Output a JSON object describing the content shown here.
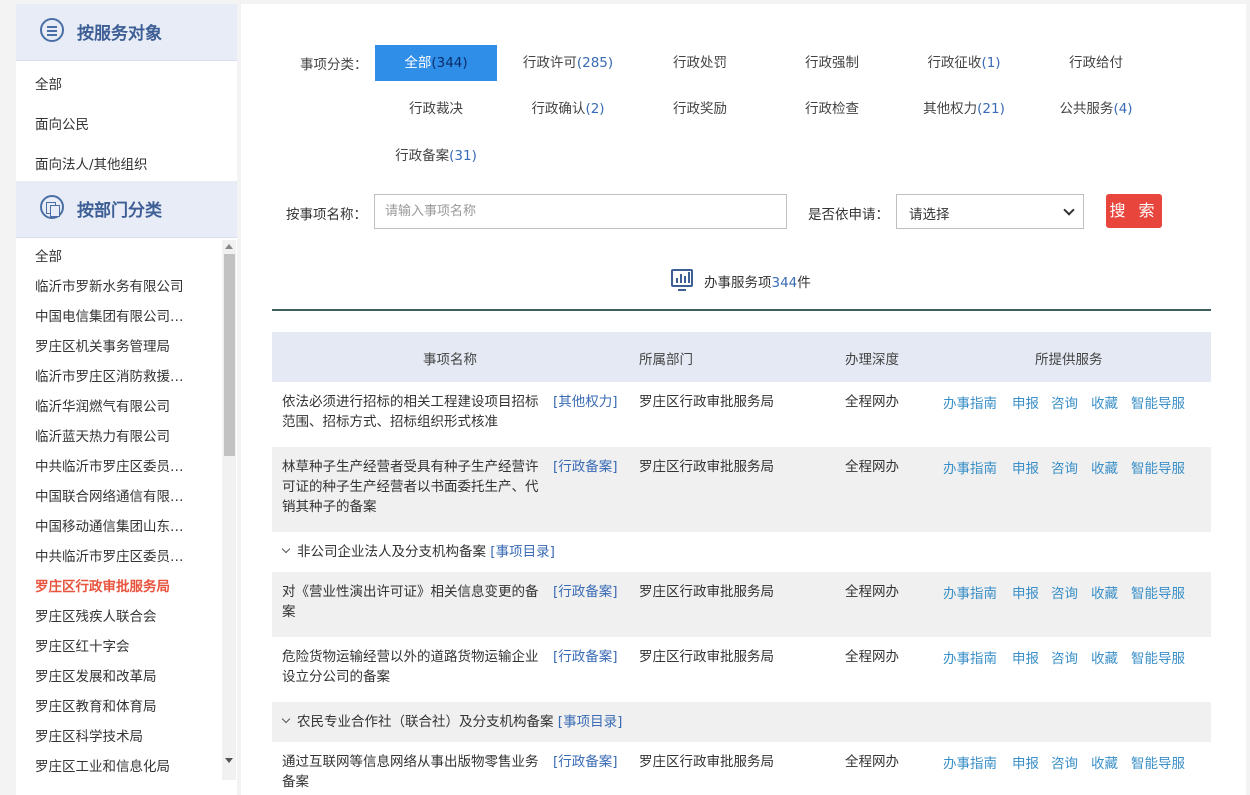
{
  "sidebar": {
    "by_target": {
      "title": "按服务对象",
      "items": [
        "全部",
        "面向公民",
        "面向法人/其他组织"
      ]
    },
    "by_dept": {
      "title": "按部门分类",
      "items": [
        "全部",
        "临沂市罗新水务有限公司",
        "中国电信集团有限公司…",
        "罗庄区机关事务管理局",
        "临沂市罗庄区消防救援…",
        "临沂华润燃气有限公司",
        "临沂蓝天热力有限公司",
        "中共临沂市罗庄区委员…",
        "中国联合网络通信有限…",
        "中国移动通信集团山东…",
        "中共临沂市罗庄区委员…",
        "罗庄区行政审批服务局",
        "罗庄区残疾人联合会",
        "罗庄区红十字会",
        "罗庄区发展和改革局",
        "罗庄区教育和体育局",
        "罗庄区科学技术局",
        "罗庄区工业和信息化局"
      ],
      "active_item": "罗庄区行政审批服务局"
    }
  },
  "filters": {
    "category_label": "事项分类：",
    "categories": [
      {
        "name": "全部",
        "count": "(344)",
        "active": true
      },
      {
        "name": "行政许可",
        "count": "(285)"
      },
      {
        "name": "行政处罚",
        "count": ""
      },
      {
        "name": "行政强制",
        "count": ""
      },
      {
        "name": "行政征收",
        "count": "(1)"
      },
      {
        "name": "行政给付",
        "count": ""
      },
      {
        "name": "行政裁决",
        "count": ""
      },
      {
        "name": "行政确认",
        "count": "(2)"
      },
      {
        "name": "行政奖励",
        "count": ""
      },
      {
        "name": "行政检查",
        "count": ""
      },
      {
        "name": "其他权力",
        "count": "(21)"
      },
      {
        "name": "公共服务",
        "count": "(4)"
      },
      {
        "name": "行政备案",
        "count": "(31)"
      }
    ],
    "name_label": "按事项名称：",
    "name_placeholder": "请输入事项名称",
    "apply_label": "是否依申请：",
    "apply_value": "请选择",
    "search_button": "搜 索"
  },
  "summary": {
    "prefix": "办事服务项",
    "count": "344",
    "suffix": "件"
  },
  "table": {
    "headers": [
      "事项名称",
      "所属部门",
      "办理深度",
      "所提供服务"
    ],
    "services": [
      "办事指南",
      "申报",
      "咨询",
      "收藏",
      "智能导服"
    ],
    "rows": [
      {
        "name": "依法必须进行招标的相关工程建设项目招标范围、招标方式、招标组织形式核准",
        "tag": "[其他权力]",
        "dept": "罗庄区行政审批服务局",
        "depth": "全程网办"
      },
      {
        "name": "林草种子生产经营者受具有种子生产经营许可证的种子生产经营者以书面委托生产、代销其种子的备案",
        "tag": "[行政备案]",
        "dept": "罗庄区行政审批服务局",
        "depth": "全程网办"
      },
      {
        "name": "对《营业性演出许可证》相关信息变更的备案",
        "tag": "[行政备案]",
        "dept": "罗庄区行政审批服务局",
        "depth": "全程网办"
      },
      {
        "name": "危险货物运输经营以外的道路货物运输企业设立分公司的备案",
        "tag": "[行政备案]",
        "dept": "罗庄区行政审批服务局",
        "depth": "全程网办"
      },
      {
        "name": "通过互联网等信息网络从事出版物零售业务备案",
        "tag": "[行政备案]",
        "dept": "罗庄区行政审批服务局",
        "depth": "全程网办"
      }
    ],
    "groups": [
      {
        "name": "非公司企业法人及分支机构备案",
        "link": "[事项目录]"
      },
      {
        "name": "农民专业合作社（联合社）及分支机构备案",
        "link": "[事项目录]"
      }
    ]
  },
  "colors": {
    "accent": "#2f8fe8",
    "search_button": "#e8453c",
    "active_sidebar": "#e8553f",
    "link": "#3a6bb5"
  }
}
